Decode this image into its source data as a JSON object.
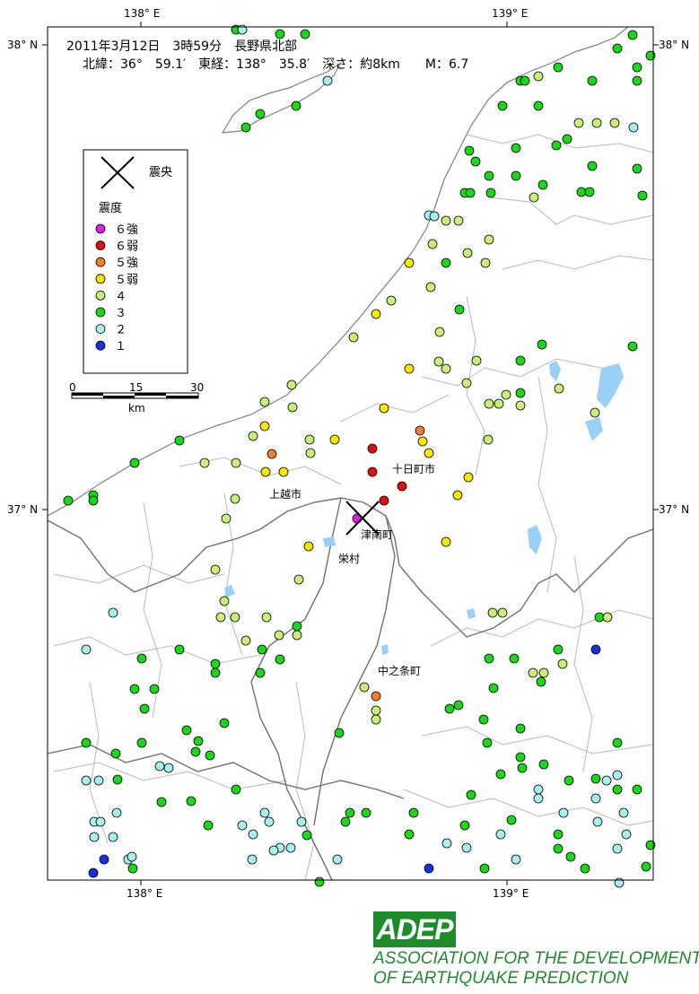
{
  "header": {
    "line1": "2011年3月12日　3時59分　長野県北部",
    "line2": "北緯：36°　59.1′　東経：138°　35.8′　深さ：約8km　　M：6.7"
  },
  "axes": {
    "top_labels": [
      "138° E",
      "139° E"
    ],
    "bottom_labels": [
      "138° E",
      "139° E"
    ],
    "left_labels": [
      "38° N",
      "37° N"
    ],
    "right_labels": [
      "38° N",
      "37° N"
    ]
  },
  "legend": {
    "epicenter_label": "震央",
    "intensity_title": "震度",
    "items": [
      {
        "label": "６強",
        "color": "#e020e0"
      },
      {
        "label": "６弱",
        "color": "#e01010"
      },
      {
        "label": "５強",
        "color": "#f08030"
      },
      {
        "label": "５弱",
        "color": "#f8e800"
      },
      {
        "label": "４",
        "color": "#c8f078"
      },
      {
        "label": "３",
        "color": "#18d818"
      },
      {
        "label": "２",
        "color": "#a8f0f0"
      },
      {
        "label": "１",
        "color": "#1830e0"
      }
    ]
  },
  "scale_bar": {
    "ticks": [
      "0",
      "15",
      "30"
    ],
    "unit": "km"
  },
  "towns": [
    {
      "name": "十日町市"
    },
    {
      "name": "上越市"
    },
    {
      "name": "津南町"
    },
    {
      "name": "栄村"
    },
    {
      "name": "中之条町"
    }
  ],
  "logo": {
    "acronym": "ADEP",
    "line1": "ASSOCIATION  FOR THE DEVELOPMENT",
    "line2": "OF EARTHQUAKE PREDICTION"
  },
  "colors": {
    "lake": "#9ad0f5",
    "boundary": "#b8b8b8",
    "prefecture": "#707070"
  }
}
